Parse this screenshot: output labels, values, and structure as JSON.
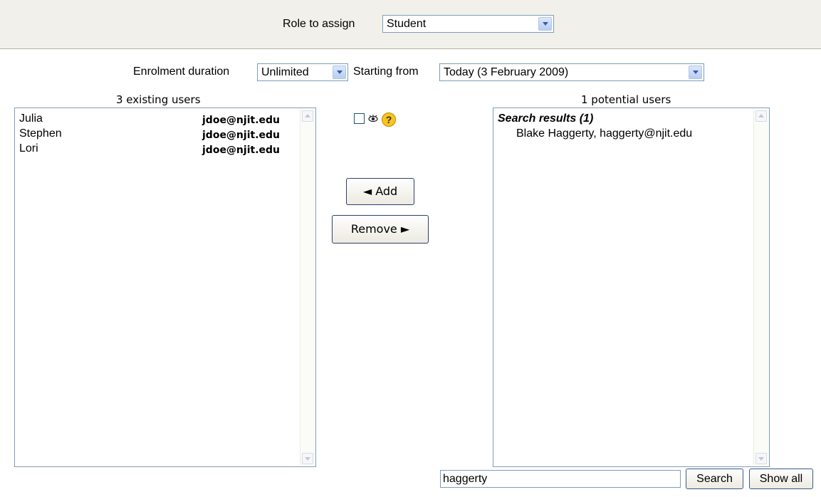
{
  "role": {
    "label": "Role to assign",
    "value": "Student"
  },
  "enrolment": {
    "duration_label": "Enrolment duration",
    "duration_value": "Unlimited",
    "start_label": "Starting from",
    "start_value": "Today (3 February 2009)"
  },
  "existing": {
    "heading": "3 existing users",
    "users": [
      {
        "name": "Julia",
        "email": "jdoe@njit.edu"
      },
      {
        "name": "Stephen",
        "email": "jdoe@njit.edu"
      },
      {
        "name": "Lori",
        "email": "jdoe@njit.edu"
      }
    ]
  },
  "controls": {
    "add_label": "◄ Add",
    "remove_label": "Remove ►",
    "help_glyph": "?"
  },
  "potential": {
    "heading": "1 potential users",
    "group_label": "Search results (1)",
    "items": [
      "Blake Haggerty, haggerty@njit.edu"
    ]
  },
  "search": {
    "value": "haggerty",
    "search_label": "Search",
    "showall_label": "Show all"
  },
  "colors": {
    "top_bar": "#f1f0ea",
    "field_border": "#7f9db9",
    "help_icon": "#f7c51e"
  }
}
